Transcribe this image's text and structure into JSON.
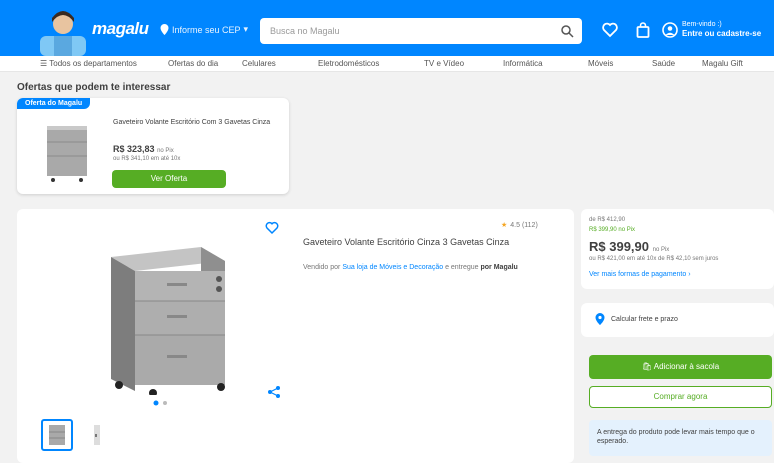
{
  "header": {
    "brand": "magalu",
    "location": "Informe seu CEP",
    "search_placeholder": "Busca no Magalu",
    "account_line1": "Bem-vindo :)",
    "account_line2": "Entre ou cadastre-se",
    "colors": {
      "primary": "#0086ff",
      "green": "#56ad24"
    }
  },
  "nav": {
    "items": [
      "Todos os departamentos",
      "Ofertas do dia",
      "Celulares",
      "Eletrodomésticos",
      "TV e Vídeo",
      "Informática",
      "Móveis",
      "Saúde",
      "Magalu Gift"
    ]
  },
  "offers": {
    "title": "Ofertas que podem te interessar",
    "badge": "Oferta do Magalu",
    "description": "Gaveteiro Volante Escritório Com 3 Gavetas Cinza",
    "price": "R$ 323,83",
    "price_suffix": "no Pix",
    "installments": "ou R$ 341,10 em até 10x",
    "button": "Ver Oferta"
  },
  "product": {
    "rating": "4.5 (112)",
    "title": "Gaveteiro Volante Escritório Cinza 3 Gavetas Cinza",
    "seller_prefix": "Vendido por",
    "seller_link": "Sua loja de Móveis e Decoração",
    "seller_mid": "e entregue",
    "seller_by": "por Magalu"
  },
  "pricebox": {
    "was": "de R$ 412,90",
    "discount": "R$ 399,90 no Pix",
    "price": "R$ 399,90",
    "price_suffix": "no Pix",
    "installments": "ou R$ 421,00 em até 10x de R$ 42,10 sem juros",
    "more_payment": "Ver mais formas de pagamento",
    "cep_label": "Calcular frete e prazo",
    "buy_button": "Adicionar à sacola",
    "later_button": "Comprar agora",
    "notice": "A entrega do produto pode levar mais tempo que o esperado."
  }
}
